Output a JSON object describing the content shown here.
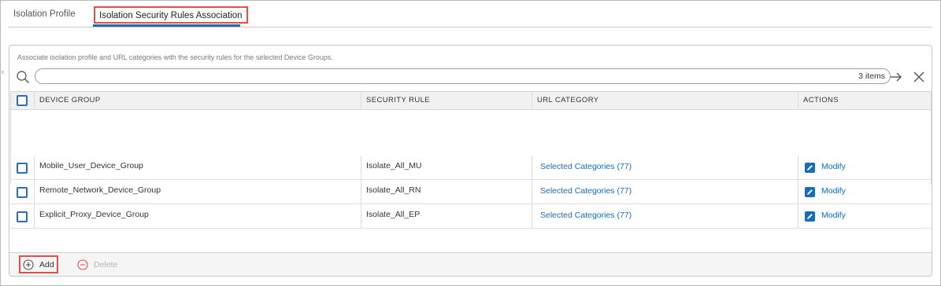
{
  "tabs": [
    {
      "label": "Isolation Profile",
      "active": false
    },
    {
      "label": "Isolation Security Rules Association",
      "active": true
    }
  ],
  "panel": {
    "description": "Associate isolation profile and URL categories with the security rules for the selected Device Groups."
  },
  "search": {
    "placeholder": "",
    "value": "",
    "items_count": "3 items"
  },
  "table": {
    "columns": [
      "DEVICE GROUP",
      "SECURITY RULE",
      "URL CATEGORY",
      "ACTIONS"
    ],
    "rows": [
      {
        "device_group": "Mobile_User_Device_Group",
        "security_rule": "Isolate_All_MU",
        "url_category": "Selected Categories (77)",
        "action": "Modify"
      },
      {
        "device_group": "Remote_Network_Device_Group",
        "security_rule": "Isolate_All_RN",
        "url_category": "Selected Categories (77)",
        "action": "Modify"
      },
      {
        "device_group": "Explicit_Proxy_Device_Group",
        "security_rule": "Isolate_All_EP",
        "url_category": "Selected Categories (77)",
        "action": "Modify"
      }
    ]
  },
  "footer": {
    "add_label": "Add",
    "delete_label": "Delete"
  },
  "colors": {
    "accent": "#1b6bb8",
    "highlight": "#e0504a",
    "disabled": "#b5b5b5"
  },
  "icons": [
    "search-icon",
    "arrow-right-icon",
    "close-icon",
    "edit-icon",
    "plus-circle-icon",
    "minus-circle-icon",
    "chevron-left-icon"
  ]
}
